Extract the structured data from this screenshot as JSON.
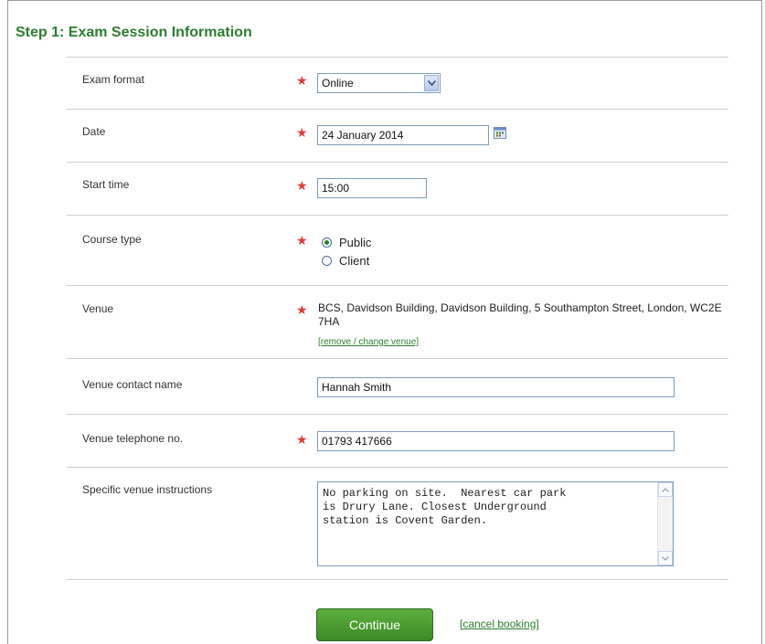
{
  "form": {
    "title": "Step 1: Exam Session Information",
    "required_marker": "★",
    "exam_format": {
      "label": "Exam format",
      "value": "Online"
    },
    "date": {
      "label": "Date",
      "value": "24 January 2014"
    },
    "start_time": {
      "label": "Start time",
      "value": "15:00"
    },
    "course_type": {
      "label": "Course type",
      "options": [
        {
          "label": "Public",
          "selected": true
        },
        {
          "label": "Client",
          "selected": false
        }
      ]
    },
    "venue": {
      "label": "Venue",
      "address": "BCS, Davidson Building, Davidson Building, 5 Southampton Street, London, WC2E 7HA",
      "change_link": "[remove / change venue]"
    },
    "contact_name": {
      "label": "Venue contact name",
      "value": "Hannah Smith"
    },
    "telephone": {
      "label": "Venue telephone no.",
      "value": "01793 417666"
    },
    "instructions": {
      "label": "Specific venue instructions",
      "value": "No parking on site.  Nearest car park\nis Drury Lane. Closest Underground\nstation is Covent Garden."
    }
  },
  "actions": {
    "continue_label": "Continue",
    "cancel_label": "[cancel booking]"
  },
  "colors": {
    "heading_green": "#2e7d32",
    "required_red": "#e53935",
    "button_green": "#3b8a25"
  }
}
